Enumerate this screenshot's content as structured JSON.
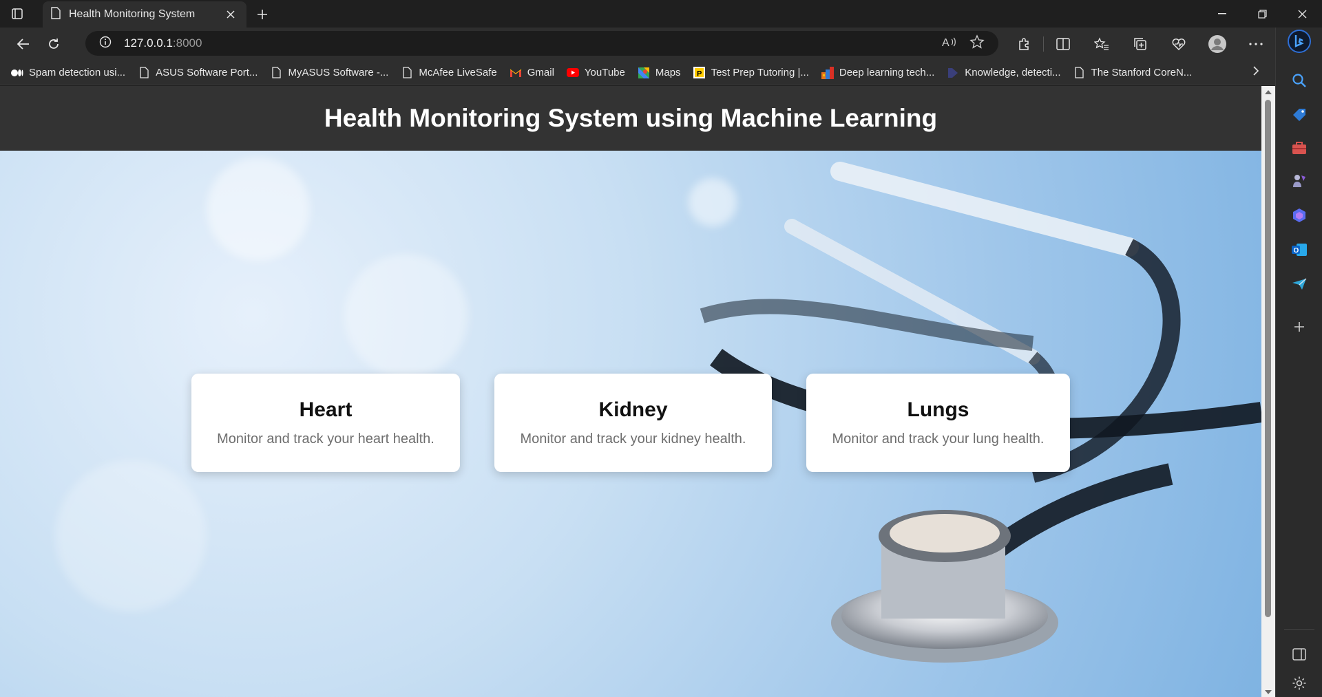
{
  "browser": {
    "tab": {
      "title": "Health Monitoring System"
    },
    "address": {
      "host": "127.0.0.1",
      "port": ":8000"
    },
    "bookmarks": [
      {
        "label": "Spam detection usi...",
        "icon": "medium-icon"
      },
      {
        "label": "ASUS Software Port...",
        "icon": "page-icon"
      },
      {
        "label": "MyASUS Software -...",
        "icon": "page-icon"
      },
      {
        "label": "McAfee LiveSafe",
        "icon": "page-icon"
      },
      {
        "label": "Gmail",
        "icon": "gmail-icon"
      },
      {
        "label": "YouTube",
        "icon": "youtube-icon"
      },
      {
        "label": "Maps",
        "icon": "maps-icon"
      },
      {
        "label": "Test Prep Tutoring |...",
        "icon": "prep-icon"
      },
      {
        "label": "Deep learning tech...",
        "icon": "colorful-icon"
      },
      {
        "label": "Knowledge, detecti...",
        "icon": "shield-icon"
      },
      {
        "label": "The Stanford CoreN...",
        "icon": "page-icon"
      }
    ]
  },
  "page": {
    "header": {
      "title": "Health Monitoring System using Machine Learning"
    },
    "cards": [
      {
        "title": "Heart",
        "description": "Monitor and track your heart health."
      },
      {
        "title": "Kidney",
        "description": "Monitor and track your kidney health."
      },
      {
        "title": "Lungs",
        "description": "Monitor and track your lung health."
      }
    ]
  },
  "colors": {
    "header_bg": "#333333",
    "card_bg": "#ffffff",
    "browser_chrome": "#2e2e2e"
  }
}
